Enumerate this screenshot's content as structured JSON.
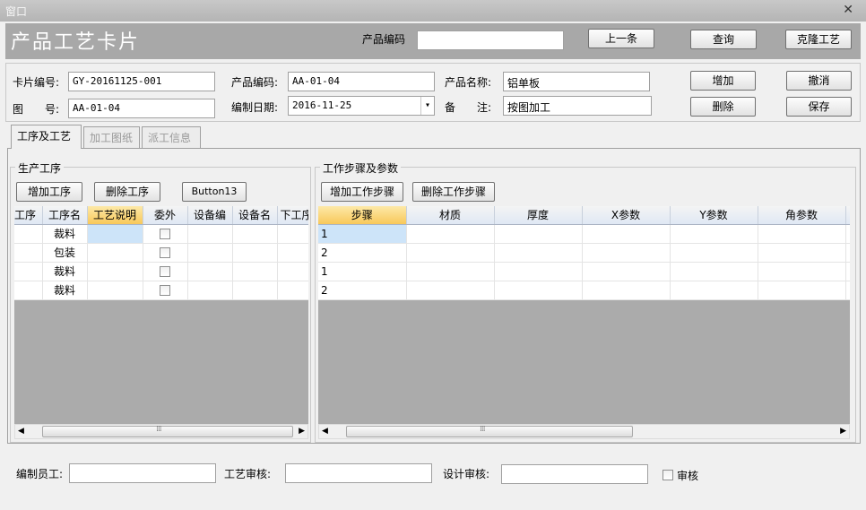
{
  "window": {
    "title": "窗口",
    "close_glyph": "✕"
  },
  "header": {
    "title": "产品工艺卡片",
    "product_code_label": "产品编码",
    "product_code_value": "",
    "prev_button": "上一条",
    "query_button": "查询",
    "clone_button": "克隆工艺"
  },
  "form": {
    "card_no_label": "卡片编号:",
    "card_no_value": "GY-20161125-001",
    "drawing_no_label": "图　　号:",
    "drawing_no_value": "AA-01-04",
    "product_code_label": "产品编码:",
    "product_code_value": "AA-01-04",
    "edit_date_label": "编制日期:",
    "edit_date_value": "2016-11-25",
    "product_name_label": "产品名称:",
    "product_name_value": "铝单板",
    "remark_label": "备　　注:",
    "remark_value": "按图加工",
    "add_button": "增加",
    "cancel_button": "撤消",
    "delete_button": "删除",
    "save_button": "保存"
  },
  "tabs": [
    "工序及工艺",
    "加工图纸",
    "派工信息"
  ],
  "processes": {
    "group_title": "生产工序",
    "add_button": "增加工序",
    "delete_button": "删除工序",
    "button13": "Button13",
    "columns": [
      "工序",
      "工序名",
      "工艺说明",
      "委外",
      "设备编",
      "设备名",
      "下工序"
    ],
    "rows": [
      {
        "name": "裁料",
        "outsourced": false
      },
      {
        "name": "包装",
        "outsourced": false
      },
      {
        "name": "裁料",
        "outsourced": false
      },
      {
        "name": "裁料",
        "outsourced": false
      }
    ]
  },
  "steps": {
    "group_title": "工作步骤及参数",
    "add_button": "增加工作步骤",
    "delete_button": "删除工作步骤",
    "columns": [
      "步骤",
      "材质",
      "厚度",
      "X参数",
      "Y参数",
      "角参数"
    ],
    "rows": [
      {
        "step": "1"
      },
      {
        "step": "2"
      },
      {
        "step": "1"
      },
      {
        "step": "2"
      }
    ]
  },
  "footer": {
    "editor_label": "编制员工:",
    "editor_value": "",
    "process_review_label": "工艺审核:",
    "process_review_value": "",
    "design_review_label": "设计审核:",
    "design_review_value": "",
    "approve_label": "审核"
  },
  "icons": {
    "scroll_left": "◀",
    "scroll_right": "▶",
    "dropdown": "▾",
    "grip": "⁞⁞⁞"
  }
}
